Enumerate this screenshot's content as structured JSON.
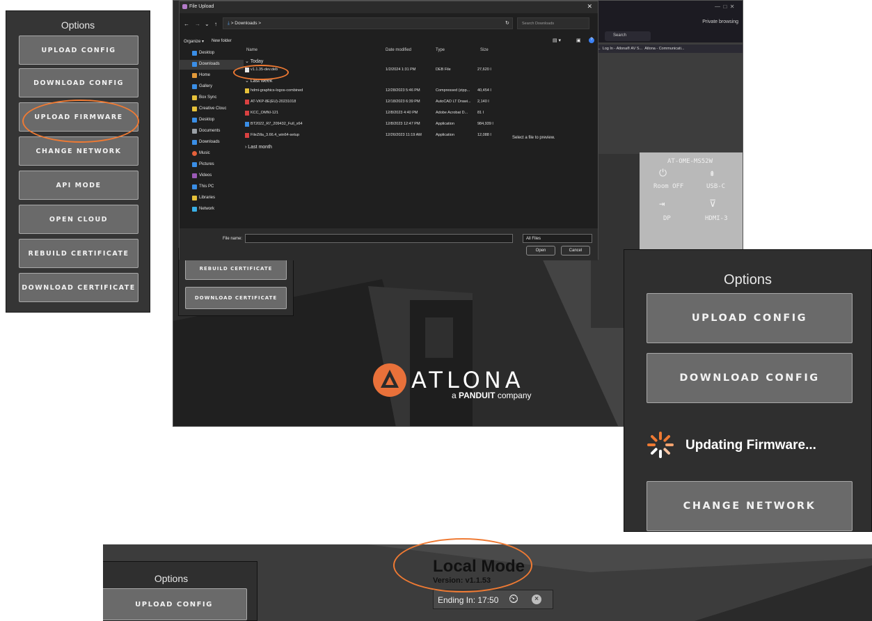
{
  "panel_a": {
    "title": "Options",
    "buttons": [
      "UPLOAD CONFIG",
      "DOWNLOAD CONFIG",
      "UPLOAD FIRMWARE",
      "CHANGE NETWORK",
      "API MODE",
      "OPEN CLOUD",
      "REBUILD CERTIFICATE",
      "DOWNLOAD CERTIFICATE"
    ]
  },
  "main_shot": {
    "mini_buttons": [
      "REBUILD CERTIFICATE",
      "DOWNLOAD CERTIFICATE"
    ],
    "browser": {
      "private_label": "Private browsing",
      "search_placeholder": "Search",
      "bookmark_1": "Log In - Atlona® AV S...",
      "bookmark_2": "Atlona - Communicati...",
      "bookmark_prefix": "zip..."
    },
    "device": {
      "model": "AT-OME-MS52W",
      "labels": [
        "Room OFF",
        "USB-C",
        "DP",
        "HDMI-3"
      ]
    },
    "logo": {
      "name": "ATLONA",
      "sub_a": "a",
      "sub_brand": "PANDUIT",
      "sub_company": "company"
    }
  },
  "dialog": {
    "title": "File Upload",
    "address": "Downloads",
    "address_sep": ">",
    "search_placeholder": "Search Downloads",
    "organize": "Organize",
    "new_folder": "New folder",
    "columns": {
      "name": "Name",
      "date": "Date modified",
      "type": "Type",
      "size": "Size"
    },
    "nav": [
      "Desktop",
      "Downloads",
      "Home",
      "Gallery",
      "Box Sync",
      "Creative Clouc",
      "Desktop",
      "Documents",
      "Downloads",
      "Music",
      "Pictures",
      "Videos",
      "This PC",
      "Libraries",
      "Network"
    ],
    "groups": {
      "today": "Today",
      "last_week": "Last week",
      "last_month": "Last month"
    },
    "files_today": [
      {
        "name": "v1.1.35-dev.deb",
        "date": "1/2/2024 1:31 PM",
        "type": "DEB File",
        "size": "27,620 I"
      }
    ],
    "files_last_week": [
      {
        "name": "hdmi-graphics-logos-combined",
        "date": "12/28/2023 5:46 PM",
        "type": "Compressed (zipp...",
        "size": "40,454 I"
      },
      {
        "name": "AT-VKP-8E(EU)-20231018",
        "date": "12/18/2023 6:39 PM",
        "type": "AutoCAD LT Drawi...",
        "size": "2,140 I"
      },
      {
        "name": "KCC_OMNI-121",
        "date": "12/8/2023 4:40 PM",
        "type": "Adobe Acrobat D...",
        "size": "81 I"
      },
      {
        "name": "BT2022_R7_209432_Full_x64",
        "date": "12/8/2023 12:47 PM",
        "type": "Application",
        "size": "984,939 I"
      },
      {
        "name": "FileZilla_3.66.4_win64-setup",
        "date": "12/26/2023 11:19 AM",
        "type": "Application",
        "size": "12,088 I"
      }
    ],
    "preview_text": "Select a file to preview.",
    "file_name_label": "File name:",
    "file_type": "All Files",
    "open": "Open",
    "cancel": "Cancel"
  },
  "panel_c": {
    "title": "Options",
    "buttons": [
      "UPLOAD CONFIG",
      "DOWNLOAD CONFIG",
      "CHANGE NETWORK"
    ],
    "status": "Updating Firmware..."
  },
  "bottom": {
    "title": "Options",
    "button": "UPLOAD CONFIG",
    "local_mode": "Local Mode",
    "version": "Version: v1.1.53",
    "ending": "Ending In: 17:50"
  },
  "colors": {
    "highlight": "#ef7a33",
    "atlona_orange": "#e9713a",
    "button_bg": "#6a6a6a",
    "panel_bg": "#353535"
  }
}
